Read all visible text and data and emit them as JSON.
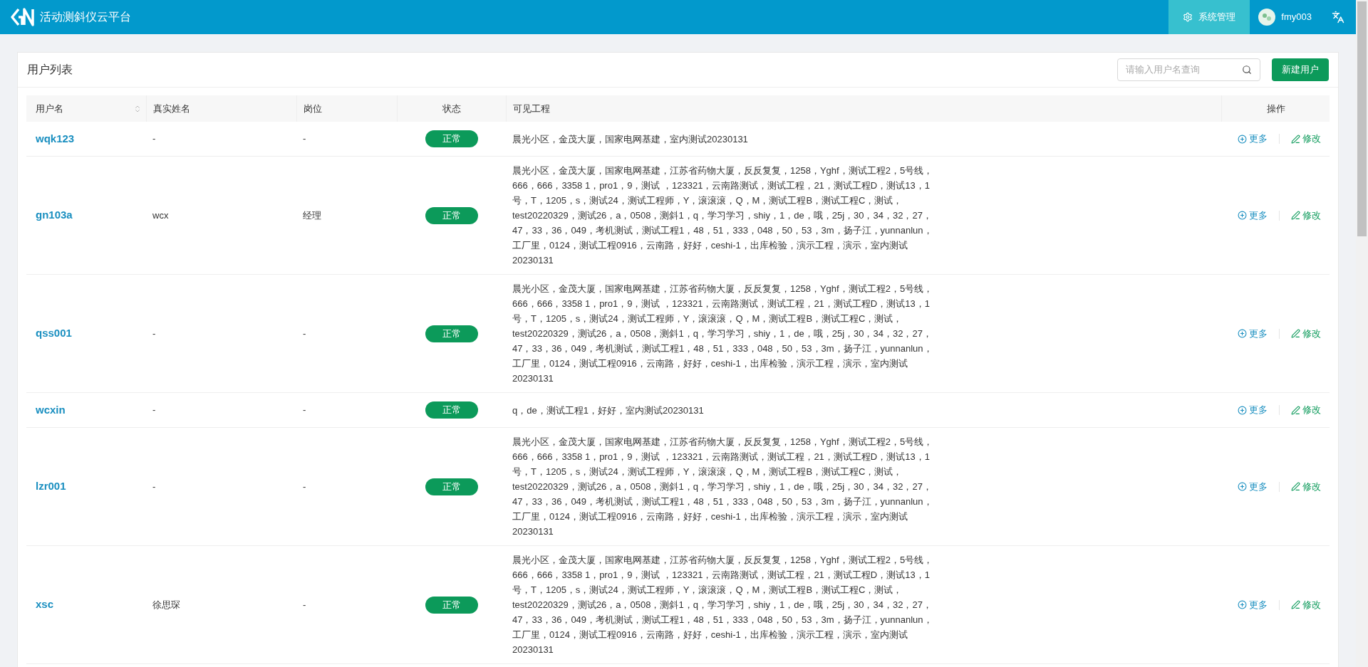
{
  "header": {
    "title": "活动测斜仪云平台",
    "menu": [
      {
        "label": "系统管理",
        "selected": true
      }
    ],
    "user": "fmy003"
  },
  "card": {
    "title": "用户列表",
    "search": {
      "placeholder": "请输入用户名查询"
    },
    "new_button": "新建用户"
  },
  "table": {
    "columns": [
      "用户名",
      "真实姓名",
      "岗位",
      "状态",
      "可见工程",
      "操作"
    ],
    "rows": [
      {
        "username": "wqk123",
        "real_name": "-",
        "position": "-",
        "status": "正常",
        "projects": "晨光小区，金茂大厦，国家电网基建，室内测试20230131",
        "actions": [
          "更多",
          "修改"
        ]
      },
      {
        "username": "gn103a",
        "real_name": "wcx",
        "position": "经理",
        "status": "正常",
        "projects": "晨光小区，金茂大厦，国家电网基建，江苏省药物大厦，反反复复，1258，Yghf，测试工程2，5号线，666，666，3358 1，pro1，9，测试 ，123321，云南路测试，测试工程，21，测试工程D，测试13，1号，T，1205，s，测试24，测试工程师，Y，滚滚滚，Q，M，测试工程B，测试工程C，测试，test20220329，测试26，a，0508，测斜1，q，学习学习，shiy，1，de，哦，25j，30，34，32，27，47，33，36，049，考机测试，测试工程1，48，51，333，048，50，53，3m，扬子江，yunnanlun，工厂里，0124，测试工程0916，云南路，好好，ceshi-1，出库检验，演示工程，演示，室内测试20230131",
        "actions": [
          "更多",
          "修改"
        ]
      },
      {
        "username": "qss001",
        "real_name": "-",
        "position": "-",
        "status": "正常",
        "projects": "晨光小区，金茂大厦，国家电网基建，江苏省药物大厦，反反复复，1258，Yghf，测试工程2，5号线，666，666，3358 1，pro1，9，测试 ，123321，云南路测试，测试工程，21，测试工程D，测试13，1号，T，1205，s，测试24，测试工程师，Y，滚滚滚，Q，M，测试工程B，测试工程C，测试，test20220329，测试26，a，0508，测斜1，q，学习学习，shiy，1，de，哦，25j，30，34，32，27，47，33，36，049，考机测试，测试工程1，48，51，333，048，50，53，3m，扬子江，yunnanlun，工厂里，0124，测试工程0916，云南路，好好，ceshi-1，出库检验，演示工程，演示，室内测试20230131",
        "actions": [
          "更多",
          "修改"
        ]
      },
      {
        "username": "wcxin",
        "real_name": "-",
        "position": "-",
        "status": "正常",
        "projects": "q，de，测试工程1，好好，室内测试20230131",
        "actions": [
          "更多",
          "修改"
        ]
      },
      {
        "username": "lzr001",
        "real_name": "-",
        "position": "-",
        "status": "正常",
        "projects": "晨光小区，金茂大厦，国家电网基建，江苏省药物大厦，反反复复，1258，Yghf，测试工程2，5号线，666，666，3358 1，pro1，9，测试 ，123321，云南路测试，测试工程，21，测试工程D，测试13，1号，T，1205，s，测试24，测试工程师，Y，滚滚滚，Q，M，测试工程B，测试工程C，测试，test20220329，测试26，a，0508，测斜1，q，学习学习，shiy，1，de，哦，25j，30，34，32，27，47，33，36，049，考机测试，测试工程1，48，51，333，048，50，53，3m，扬子江，yunnanlun，工厂里，0124，测试工程0916，云南路，好好，ceshi-1，出库检验，演示工程，演示，室内测试20230131",
        "actions": [
          "更多",
          "修改"
        ]
      },
      {
        "username": "xsc",
        "real_name": "徐思琛",
        "position": "-",
        "status": "正常",
        "projects": "晨光小区，金茂大厦，国家电网基建，江苏省药物大厦，反反复复，1258，Yghf，测试工程2，5号线，666，666，3358 1，pro1，9，测试 ，123321，云南路测试，测试工程，21，测试工程D，测试13，1号，T，1205，s，测试24，测试工程师，Y，滚滚滚，Q，M，测试工程B，测试工程C，测试，test20220329，测试26，a，0508，测斜1，q，学习学习，shiy，1，de，哦，25j，30，34，32，27，47，33，36，049，考机测试，测试工程1，48，51，333，048，50，53，3m，扬子江，yunnanlun，工厂里，0124，测试工程0916，云南路，好好，ceshi-1，出库检验，演示工程，演示，室内测试20230131",
        "actions": [
          "更多",
          "修改"
        ]
      }
    ]
  }
}
